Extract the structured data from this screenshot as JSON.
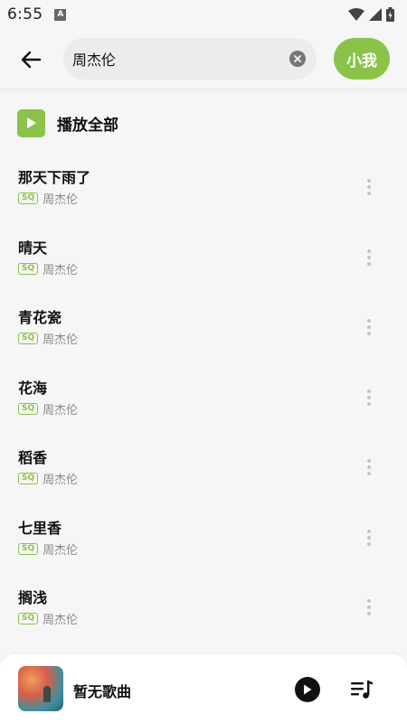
{
  "status_bar": {
    "time": "6:55",
    "notification_letter": "A"
  },
  "search": {
    "query": "周杰伦",
    "user_button": "小我"
  },
  "play_all": {
    "label": "播放全部"
  },
  "songs": [
    {
      "title": "那天下雨了",
      "quality": "SQ",
      "artist": "周杰伦"
    },
    {
      "title": "晴天",
      "quality": "SQ",
      "artist": "周杰伦"
    },
    {
      "title": "青花瓷",
      "quality": "SQ",
      "artist": "周杰伦"
    },
    {
      "title": "花海",
      "quality": "SQ",
      "artist": "周杰伦"
    },
    {
      "title": "稻香",
      "quality": "SQ",
      "artist": "周杰伦"
    },
    {
      "title": "七里香",
      "quality": "SQ",
      "artist": "周杰伦"
    },
    {
      "title": "搁浅",
      "quality": "SQ",
      "artist": "周杰伦"
    }
  ],
  "player": {
    "now_playing": "暂无歌曲"
  },
  "colors": {
    "accent": "#8bc34a",
    "background": "#f6f6f6"
  }
}
